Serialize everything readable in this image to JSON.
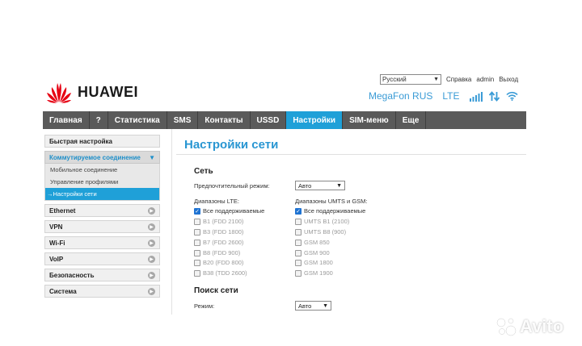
{
  "brand": {
    "name": "HUAWEI"
  },
  "top": {
    "language": "Русский",
    "help": "Справка",
    "user": "admin",
    "logout": "Выход"
  },
  "status": {
    "operator": "MegaFon RUS",
    "network": "LTE"
  },
  "nav": {
    "items": [
      {
        "label": "Главная",
        "active": false
      },
      {
        "label": "?",
        "active": false
      },
      {
        "label": "Статистика",
        "active": false
      },
      {
        "label": "SMS",
        "active": false
      },
      {
        "label": "Контакты",
        "active": false
      },
      {
        "label": "USSD",
        "active": false
      },
      {
        "label": "Настройки",
        "active": true
      },
      {
        "label": "SIM-меню",
        "active": false
      },
      {
        "label": "Еще",
        "active": false
      }
    ]
  },
  "sidebar": {
    "quick_setup": "Быстрая настройка",
    "dialup": {
      "label": "Коммутируемое соединение",
      "subitems": [
        {
          "label": "Мобильное соединение"
        },
        {
          "label": "Управление профилями"
        },
        {
          "label": "Настройки сети",
          "active": true
        }
      ]
    },
    "items": [
      {
        "label": "Ethernet"
      },
      {
        "label": "VPN"
      },
      {
        "label": "Wi-Fi"
      },
      {
        "label": "VoIP"
      },
      {
        "label": "Безопасность"
      },
      {
        "label": "Система"
      }
    ]
  },
  "main": {
    "title": "Настройки сети",
    "network": {
      "heading": "Сеть",
      "preferred_mode_label": "Предпочтительный режим:",
      "preferred_mode_value": "Авто",
      "lte_label": "Диапазоны LTE:",
      "lte_bands": [
        {
          "label": "Все поддерживаемые",
          "checked": true,
          "disabled": false
        },
        {
          "label": "B1 (FDD 2100)",
          "checked": false,
          "disabled": true
        },
        {
          "label": "B3 (FDD 1800)",
          "checked": false,
          "disabled": true
        },
        {
          "label": "B7 (FDD 2600)",
          "checked": false,
          "disabled": true
        },
        {
          "label": "B8 (FDD 900)",
          "checked": false,
          "disabled": true
        },
        {
          "label": "B20 (FDD 800)",
          "checked": false,
          "disabled": true
        },
        {
          "label": "B38 (TDD 2600)",
          "checked": false,
          "disabled": true
        }
      ],
      "umts_label": "Диапазоны UMTS и GSM:",
      "umts_bands": [
        {
          "label": "Все поддерживаемые",
          "checked": true,
          "disabled": false
        },
        {
          "label": "UMTS B1 (2100)",
          "checked": false,
          "disabled": true
        },
        {
          "label": "UMTS B8 (900)",
          "checked": false,
          "disabled": true
        },
        {
          "label": "GSM 850",
          "checked": false,
          "disabled": true
        },
        {
          "label": "GSM 900",
          "checked": false,
          "disabled": true
        },
        {
          "label": "GSM 1800",
          "checked": false,
          "disabled": true
        },
        {
          "label": "GSM 1900",
          "checked": false,
          "disabled": true
        }
      ]
    },
    "search": {
      "heading": "Поиск сети",
      "mode_label": "Режим:",
      "mode_value": "Авто"
    }
  },
  "watermark": {
    "text": "Avito"
  },
  "colors": {
    "accent": "#1fa0d8",
    "nav_bg": "#5a5a5a",
    "title": "#2996d2",
    "huawei_red": "#e60012"
  }
}
